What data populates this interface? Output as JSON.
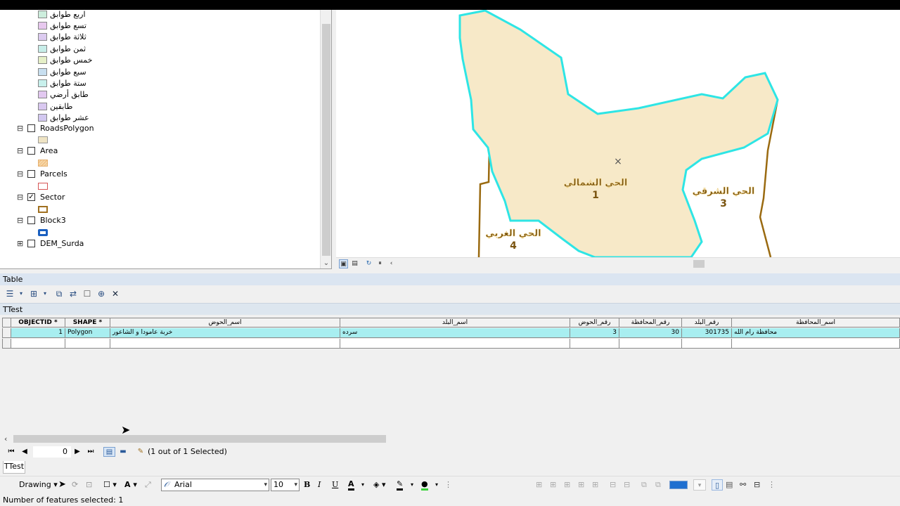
{
  "toc": {
    "class_items": [
      {
        "label": "اربع طوابق",
        "color": "#cdeedd"
      },
      {
        "label": "تسع طوابق",
        "color": "#e7c8ee"
      },
      {
        "label": "ثلاثة طوابق",
        "color": "#dccbf0"
      },
      {
        "label": "ثمن طوابق",
        "color": "#c8eee9"
      },
      {
        "label": "خمس طوابق",
        "color": "#e6f0c8"
      },
      {
        "label": "سبع طوابق",
        "color": "#c8dff0"
      },
      {
        "label": "ستة طوابق",
        "color": "#c8f0ec"
      },
      {
        "label": "طابق أرضي",
        "color": "#e2c8f0"
      },
      {
        "label": "طابقين",
        "color": "#d9c8f0"
      },
      {
        "label": "عشر طوابق",
        "color": "#d2c8f0"
      }
    ],
    "layers": [
      {
        "name": "RoadsPolygon",
        "checked": false,
        "expander": "⊟"
      },
      {
        "name": "Area",
        "checked": false,
        "expander": "⊟"
      },
      {
        "name": "Parcels",
        "checked": false,
        "expander": "⊟"
      },
      {
        "name": "Sector",
        "checked": true,
        "expander": "⊟"
      },
      {
        "name": "Block3",
        "checked": false,
        "expander": "⊟"
      },
      {
        "name": "DEM_Surda",
        "checked": false,
        "expander": "⊞"
      }
    ],
    "check_mark": "✓"
  },
  "map": {
    "labels": [
      {
        "name": "الحي الشمالي",
        "num": "1"
      },
      {
        "name": "الحي الشرقي",
        "num": "3"
      },
      {
        "name": "الحي الغربي",
        "num": "4"
      }
    ],
    "fill_color": "#f7e9c8",
    "border_color": "#2ee5e5",
    "sector_color": "#9a6a10",
    "center_mark": "×"
  },
  "table": {
    "window_title": "Table",
    "tab_name": "TTest",
    "columns": [
      "OBJECTID *",
      "SHAPE *",
      "اسم_الحوض",
      "اسم_البلد",
      "رقم_الحوض",
      "رقم_المحافظة",
      "رقم_البلد",
      "اسم_المحافظة"
    ],
    "row": {
      "objectid": "1",
      "shape": "Polygon",
      "basin_name": "خربة عامودا و الشاعور",
      "town_name": "سرده",
      "basin_no": "3",
      "gov_no": "30",
      "town_no": "301735",
      "gov_name": "محافظة رام الله"
    },
    "record_number": "0",
    "selection_status": "(1 out of 1 Selected)",
    "bottom_tab": "TTest"
  },
  "drawing": {
    "menu_label": "Drawing",
    "font_name": "Arial",
    "font_size": "10",
    "bold": "B",
    "italic": "I",
    "underline": "U",
    "font_color_letter": "A",
    "highlight_color": "#1f6fd0"
  },
  "status": {
    "text": "Number of features selected: 1"
  }
}
